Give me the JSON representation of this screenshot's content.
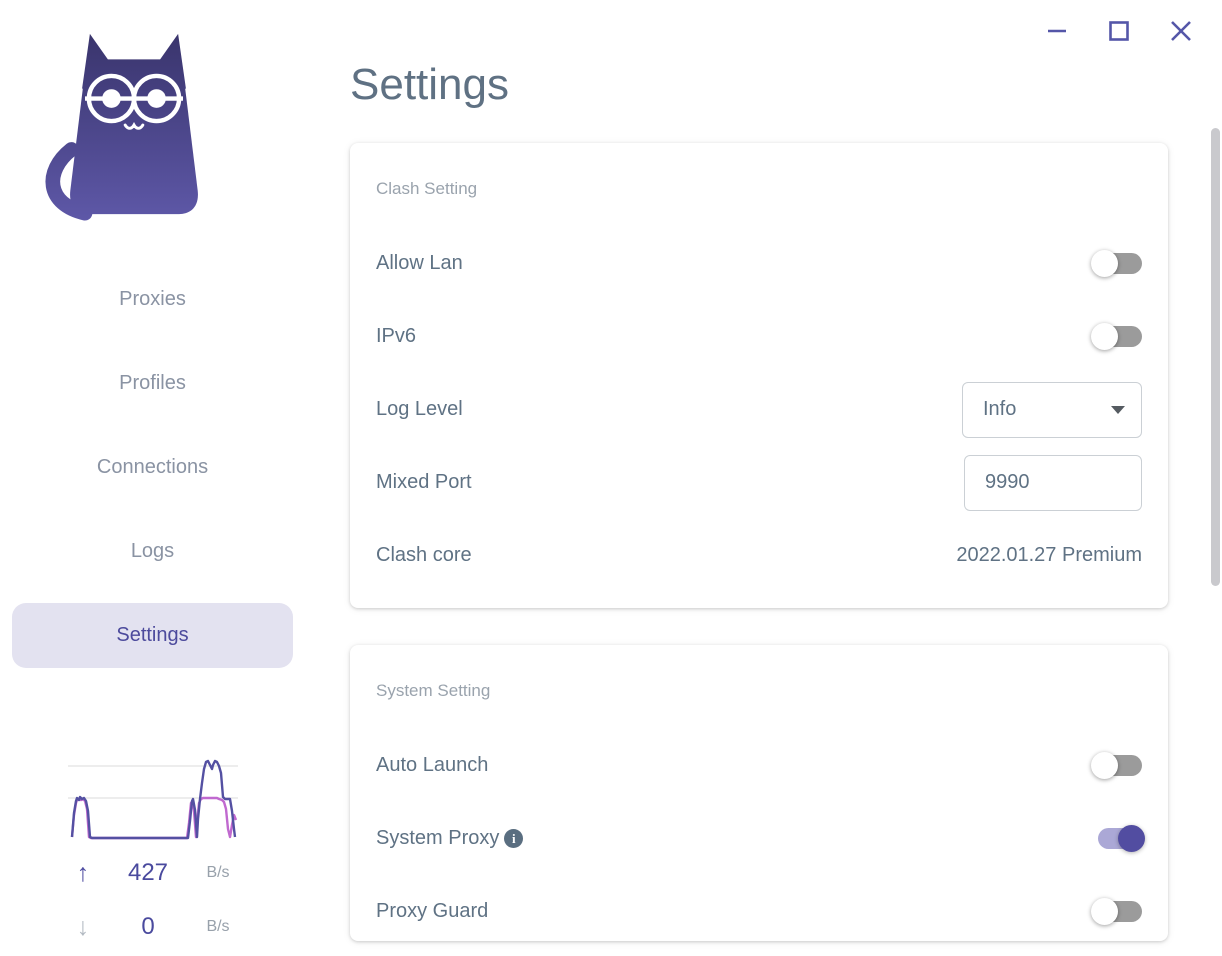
{
  "window": {
    "controls": {
      "minimize": "minimize",
      "maximize": "maximize",
      "close": "close"
    }
  },
  "sidebar": {
    "nav": [
      {
        "label": "Proxies",
        "active": false
      },
      {
        "label": "Profiles",
        "active": false
      },
      {
        "label": "Connections",
        "active": false
      },
      {
        "label": "Logs",
        "active": false
      },
      {
        "label": "Settings",
        "active": true
      }
    ],
    "traffic": {
      "upload": {
        "value": "427",
        "unit": "B/s"
      },
      "download": {
        "value": "0",
        "unit": "B/s"
      },
      "up_color": "#5450a2",
      "down_color": "#c069cf"
    }
  },
  "main": {
    "title": "Settings",
    "cards": [
      {
        "header": "Clash Setting",
        "rows": [
          {
            "label": "Allow Lan",
            "control": "toggle",
            "state": "off"
          },
          {
            "label": "IPv6",
            "control": "toggle",
            "state": "off"
          },
          {
            "label": "Log Level",
            "control": "select",
            "value": "Info"
          },
          {
            "label": "Mixed Port",
            "control": "input",
            "value": "9990"
          },
          {
            "label": "Clash core",
            "control": "text",
            "value": "2022.01.27 Premium"
          }
        ]
      },
      {
        "header": "System Setting",
        "rows": [
          {
            "label": "Auto Launch",
            "control": "toggle",
            "state": "off"
          },
          {
            "label": "System Proxy",
            "control": "toggle",
            "state": "on",
            "info_icon": "i"
          },
          {
            "label": "Proxy Guard",
            "control": "toggle",
            "state": "off"
          }
        ]
      }
    ]
  },
  "colors": {
    "accent": "#504b9f",
    "active_pill_bg": "#e3e2f0",
    "nav_text": "#8a93a3",
    "text_primary": "#5f7284",
    "text_secondary": "#9aa3ad",
    "toggle_on_track": "#aba8d6",
    "toggle_on_thumb": "#524da1",
    "toggle_off_track": "#9b9b9b"
  }
}
